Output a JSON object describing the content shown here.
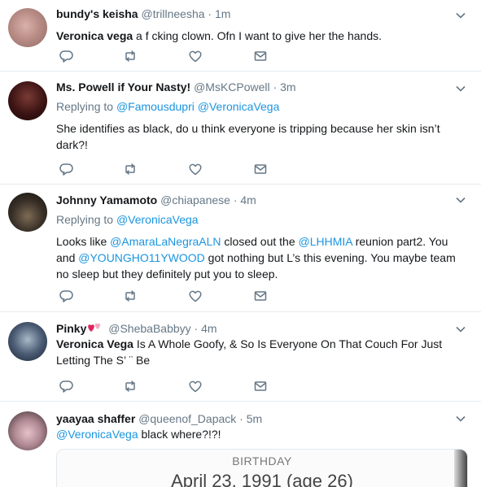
{
  "tweets": [
    {
      "name": "bundy's keisha",
      "handle": "@trillneesha",
      "time": "1m",
      "segments": [
        {
          "t": "Veronica vega",
          "b": true
        },
        {
          "t": " a f  cking clown. Ofn I want to give her the hands."
        }
      ]
    },
    {
      "name": "Ms. Powell if Your Nasty!",
      "handle": "@MsKCPowell",
      "time": "3m",
      "replying_label": "Replying to",
      "replying_to": [
        "@Famousdupri",
        "@VeronicaVega"
      ],
      "segments": [
        {
          "t": "She identifies as black, do u think everyone is tripping because her skin isn’t dark?!"
        }
      ]
    },
    {
      "name": "Johnny Yamamoto",
      "handle": "@chiapanese",
      "time": "4m",
      "replying_label": "Replying to",
      "replying_to": [
        "@VeronicaVega"
      ],
      "segments": [
        {
          "t": "Looks like "
        },
        {
          "t": "@AmaraLaNegraALN",
          "link": true
        },
        {
          "t": " closed out the "
        },
        {
          "t": "@LHHMIA",
          "link": true
        },
        {
          "t": " reunion part2. You and "
        },
        {
          "t": "@YOUNGHO11YWOOD",
          "link": true
        },
        {
          "t": " got nothing but L’s this evening. You maybe team no sleep but they definitely put you to sleep."
        }
      ]
    },
    {
      "name": "Pinky",
      "handle": "@ShebaBabbyy",
      "time": "4m",
      "name_emoji": "hearts-emoji",
      "segments": [
        {
          "t": "Veronica Vega",
          "b": true
        },
        {
          "t": " Is A Whole Goofy, & So Is Everyone On That Couch For Just Letting The S’ ¨ Be"
        }
      ]
    },
    {
      "name": "yaayaa shaffer",
      "handle": "@queenof_Dapack",
      "time": "5m",
      "segments": [
        {
          "t": "@VeronicaVega",
          "link": true
        },
        {
          "t": " black where?!?!"
        }
      ]
    }
  ],
  "card": {
    "label": "BIRTHDAY",
    "value": "April 23, 1991 (age 26)"
  },
  "icons": {
    "reply": "reply-icon",
    "retweet": "retweet-icon",
    "like": "like-icon",
    "dm": "direct-message-icon",
    "caret": "chevron-down-icon"
  },
  "colors": {
    "link": "#1b95e0",
    "muted": "#657786",
    "text": "#14171a",
    "heart": "#e0245e"
  }
}
